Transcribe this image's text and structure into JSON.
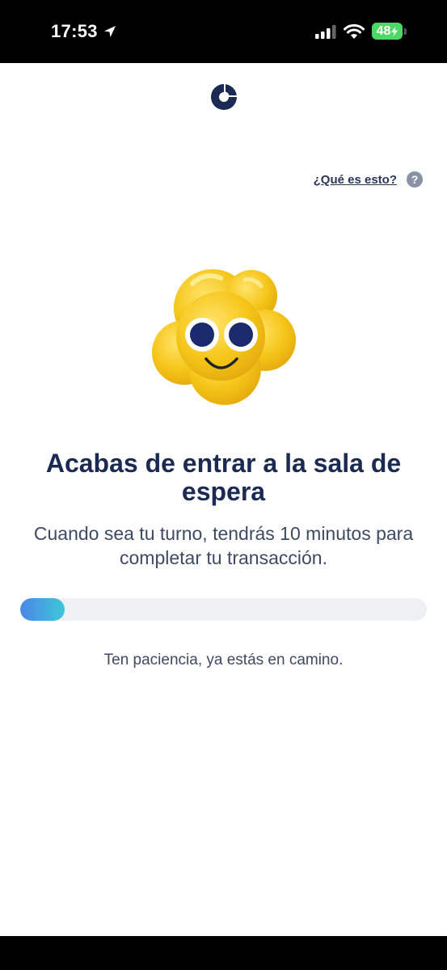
{
  "status_bar": {
    "time": "17:53",
    "battery": "48",
    "icons": [
      "location-arrow-icon",
      "signal-icon",
      "wifi-icon",
      "battery-charging-icon"
    ]
  },
  "header": {
    "logo": "c-logo-icon"
  },
  "help": {
    "link_label": "¿Qué es esto?",
    "icon_label": "?"
  },
  "main": {
    "mascot": "smiling-yellow-mascot",
    "title": "Acabas de entrar a la sala de espera",
    "subtitle": "Cuando sea tu turno, tendrás 10 minutos para completar tu transacción.",
    "progress_fraction": 0.11,
    "patience_text": "Ten paciencia, ya estás en camino."
  },
  "colors": {
    "title": "#1a2a52",
    "progress_start": "#4a86e8",
    "progress_end": "#3fc6d9",
    "track": "#eef0f4",
    "mascot": "#f5c518"
  }
}
